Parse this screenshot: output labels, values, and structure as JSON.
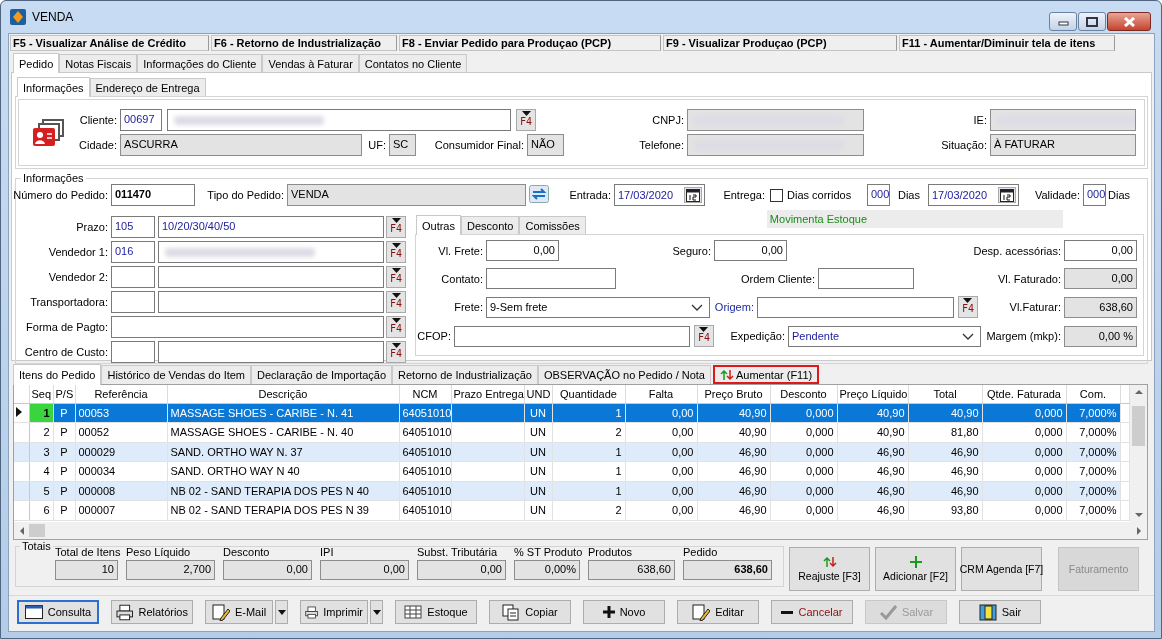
{
  "window": {
    "title": "VENDA"
  },
  "shortcuts": [
    "F5 - Visualizar Análise de Crédito",
    "F6 - Retorno de Industrialização",
    "F8 - Enviar Pedido para Produçao (PCP)",
    "F9 - Visualizar Produçao (PCP)",
    "F11 - Aumentar/Diminuir tela de itens"
  ],
  "tabs": [
    {
      "label": "Pedido",
      "selected": true
    },
    {
      "label": "Notas Fiscais",
      "selected": false
    },
    {
      "label": "Informações do Cliente",
      "selected": false
    },
    {
      "label": "Vendas à Faturar",
      "selected": false
    },
    {
      "label": "Contatos no Cliente",
      "selected": false
    }
  ],
  "sub_tabs": [
    {
      "label": "Informações",
      "selected": true
    },
    {
      "label": "Endereço de Entrega",
      "selected": false
    }
  ],
  "client": {
    "cliente": {
      "label": "Cliente:",
      "code": "00697",
      "redacted": true,
      "button": "F4"
    },
    "cnpj": {
      "label": "CNPJ:",
      "redacted": true
    },
    "ie": {
      "label": "IE:",
      "redacted": true
    },
    "cidade": {
      "label": "Cidade:",
      "value": "ASCURRA"
    },
    "uf": {
      "label": "UF:",
      "value": "SC"
    },
    "consumidor_final": {
      "label": "Consumidor Final:",
      "value": "NÃO"
    },
    "telefone": {
      "label": "Telefone:",
      "redacted": true
    },
    "situacao": {
      "label": "Situação:",
      "value": "À FATURAR"
    }
  },
  "info": {
    "title": "Informações",
    "numero": {
      "label": "Número do Pedido:",
      "value": "011470"
    },
    "tipo": {
      "label": "Tipo do Pedido:",
      "value": "VENDA"
    },
    "entrada": {
      "label": "Entrada:",
      "value": "17/03/2020"
    },
    "entrega": {
      "label": "Entrega:",
      "dias_corridos": {
        "label": "Dias corridos",
        "checked": false
      },
      "dias": "000",
      "dias_unit": "Dias",
      "value": "17/03/2020"
    },
    "validade": {
      "label": "Validade:",
      "value": "000",
      "unit": "Dias"
    },
    "stock_note": "Movimenta Estoque",
    "form": [
      {
        "label": "Prazo:",
        "kind": "split",
        "code": "105",
        "value": "10/20/30/40/50",
        "button": "F4"
      },
      {
        "label": "Vendedor 1:",
        "kind": "split",
        "code": "016",
        "redacted": true,
        "button": "F4"
      },
      {
        "label": "Vendedor 2:",
        "kind": "split",
        "button": "F4"
      },
      {
        "label": "Transportadora:",
        "kind": "split",
        "button": "F4"
      },
      {
        "label": "Forma de Pagto:",
        "kind": "single",
        "button": "F4"
      },
      {
        "label": "Centro de Custo:",
        "kind": "split",
        "button": "F4"
      }
    ],
    "panel_tabs": [
      {
        "label": "Outras",
        "selected": true
      },
      {
        "label": "Desconto",
        "selected": false
      },
      {
        "label": "Comissões",
        "selected": false
      }
    ],
    "panel_fields": [
      {
        "label": "Vl. Frete:",
        "kind": "number",
        "value": "0,00"
      },
      {
        "label": "Seguro:",
        "kind": "number",
        "value": "0,00"
      },
      {
        "label": "Desp. acessórias:",
        "kind": "number",
        "value": "0,00"
      },
      {
        "label": "Contato:",
        "kind": "text"
      },
      {
        "label": "Ordem Cliente:",
        "kind": "text"
      },
      {
        "label": "Vl. Faturado:",
        "kind": "readonly",
        "value": "0,00"
      },
      {
        "label": "Frete:",
        "kind": "select",
        "value": "9-Sem frete"
      },
      {
        "label": "Origem:",
        "kind": "lookup",
        "button": "F4",
        "color": "#1f2aa0"
      },
      {
        "label": "Vl.Faturar:",
        "kind": "readonly",
        "value": "638,60"
      },
      {
        "label": "CFOP:",
        "kind": "lookup",
        "button": "F4"
      },
      {
        "label": "Expedição:",
        "kind": "select",
        "value": "Pendente"
      },
      {
        "label": "Margem (mkp):",
        "kind": "readonly",
        "value": "0,00 %"
      }
    ]
  },
  "item_tabs": [
    {
      "label": "Itens do Pedido",
      "kind": "tab",
      "selected": true
    },
    {
      "label": "Histórico de Vendas do Item",
      "kind": "tab",
      "selected": false
    },
    {
      "label": "Declaração de Importação",
      "kind": "tab",
      "selected": false
    },
    {
      "label": "Retorno de Industrialização",
      "kind": "tab",
      "selected": false
    },
    {
      "label": "OBSERVAÇÃO no Pedido / Nota",
      "kind": "tab",
      "selected": false
    },
    {
      "label": "Aumentar (F11)",
      "kind": "action",
      "selected": false
    }
  ],
  "table": {
    "columns": [
      "Seq",
      "P/S",
      "Referência",
      "Descrição",
      "NCM",
      "Prazo Entrega",
      "UND",
      "Quantidade",
      "Falta",
      "Preço Bruto",
      "Desconto",
      "Preço Líquido",
      "Total",
      "Qtde. Faturada",
      "Com."
    ],
    "rows": [
      {
        "selected": true,
        "cells": [
          "1",
          "P",
          "00053",
          "MASSAGE SHOES - CARIBE - N. 41",
          "64051010",
          "",
          "UN",
          "1",
          "0,00",
          "40,90",
          "0,000",
          "40,90",
          "40,90",
          "0,000",
          "7,000%"
        ]
      },
      {
        "selected": false,
        "cells": [
          "2",
          "P",
          "00052",
          "MASSAGE SHOES - CARIBE - N. 40",
          "64051010",
          "",
          "UN",
          "2",
          "0,00",
          "40,90",
          "0,000",
          "40,90",
          "81,80",
          "0,000",
          "7,000%"
        ]
      },
      {
        "selected": false,
        "cells": [
          "3",
          "P",
          "000029",
          "SAND. ORTHO WAY N. 37",
          "64051010",
          "",
          "UN",
          "1",
          "0,00",
          "46,90",
          "0,000",
          "46,90",
          "46,90",
          "0,000",
          "7,000%"
        ]
      },
      {
        "selected": false,
        "cells": [
          "4",
          "P",
          "000034",
          "SAND. ORTHO WAY N 40",
          "64051010",
          "",
          "UN",
          "1",
          "0,00",
          "46,90",
          "0,000",
          "46,90",
          "46,90",
          "0,000",
          "7,000%"
        ]
      },
      {
        "selected": false,
        "cells": [
          "5",
          "P",
          "000008",
          "NB 02 - SAND TERAPIA DOS PES N 40",
          "64051010",
          "",
          "UN",
          "1",
          "0,00",
          "46,90",
          "0,000",
          "46,90",
          "46,90",
          "0,000",
          "7,000%"
        ]
      },
      {
        "selected": false,
        "cells": [
          "6",
          "P",
          "000007",
          "NB 02 - SAND TERAPIA DOS PES N 39",
          "64051010",
          "",
          "UN",
          "2",
          "0,00",
          "46,90",
          "0,000",
          "46,90",
          "93,80",
          "0,000",
          "7,000%"
        ]
      }
    ]
  },
  "totals": {
    "title": "Totais",
    "items": [
      {
        "label": "Total de Itens",
        "value": "10",
        "bold": false
      },
      {
        "label": "Peso Líquido",
        "value": "2,700",
        "bold": false
      },
      {
        "label": "Desconto",
        "value": "0,00",
        "bold": false
      },
      {
        "label": "IPI",
        "value": "0,00",
        "bold": false
      },
      {
        "label": "Subst. Tributária",
        "value": "0,00",
        "bold": false
      },
      {
        "label": "% ST Produto",
        "value": "0,00%",
        "bold": false
      },
      {
        "label": "Produtos",
        "value": "638,60",
        "bold": false
      },
      {
        "label": "Pedido",
        "value": "638,60",
        "bold": true
      }
    ]
  },
  "actions": [
    {
      "label": "Reajuste [F3]",
      "disabled": false
    },
    {
      "label": "Adicionar [F2]",
      "disabled": false
    },
    {
      "label": "CRM Agenda [F7]",
      "disabled": false
    },
    {
      "label": "Faturamento",
      "disabled": true
    }
  ],
  "toolbar": [
    {
      "label": "Consulta",
      "focused": true,
      "disabled": false,
      "dropdown": false
    },
    {
      "label": "Relatórios",
      "focused": false,
      "disabled": false,
      "dropdown": false
    },
    {
      "label": "E-Mail",
      "focused": false,
      "disabled": false,
      "dropdown": true
    },
    {
      "label": "Imprimir",
      "focused": false,
      "disabled": false,
      "dropdown": true
    },
    {
      "label": "Estoque",
      "focused": false,
      "disabled": false,
      "dropdown": false
    },
    {
      "label": "Copiar",
      "focused": false,
      "disabled": false,
      "dropdown": false
    },
    {
      "label": "Novo",
      "focused": false,
      "disabled": false,
      "dropdown": false
    },
    {
      "label": "Editar",
      "focused": false,
      "disabled": false,
      "dropdown": false
    },
    {
      "label": "Cancelar",
      "focused": false,
      "disabled": false,
      "dropdown": false,
      "color": "#8b1010"
    },
    {
      "label": "Salvar",
      "focused": false,
      "disabled": true,
      "dropdown": false
    },
    {
      "label": "Sair",
      "focused": false,
      "disabled": false,
      "dropdown": false
    }
  ]
}
